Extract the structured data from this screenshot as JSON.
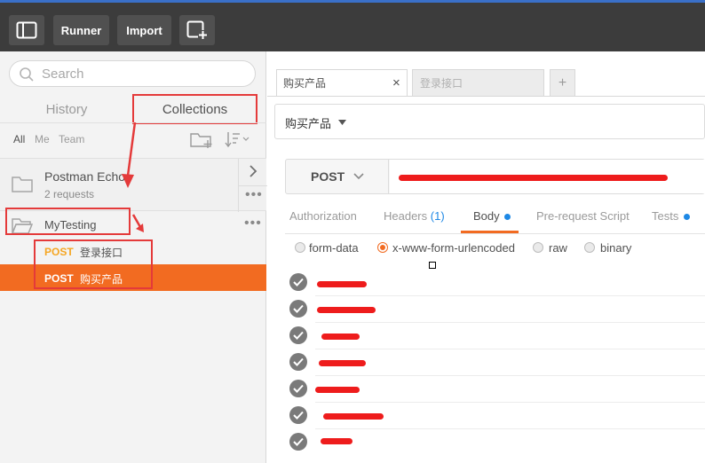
{
  "toolbar": {
    "runner_label": "Runner",
    "import_label": "Import"
  },
  "sidebar": {
    "search_placeholder": "Search",
    "tabs": {
      "history": "History",
      "collections": "Collections"
    },
    "filters": {
      "all": "All",
      "me": "Me",
      "team": "Team"
    },
    "collections": [
      {
        "name": "Postman Echo",
        "count": "2 requests"
      },
      {
        "name": "MyTesting"
      }
    ],
    "requests": [
      {
        "method": "POST",
        "name": "登录接口"
      },
      {
        "method": "POST",
        "name": "购买产品"
      }
    ]
  },
  "main": {
    "tabs": [
      {
        "label": "购买产品"
      },
      {
        "label": "登录接口"
      }
    ],
    "request_name": "购买产品",
    "method": "POST",
    "subtabs": {
      "authorization": "Authorization",
      "headers": "Headers",
      "headers_count": "(1)",
      "body": "Body",
      "prerequest": "Pre-request Script",
      "tests": "Tests"
    },
    "body_options": [
      "form-data",
      "x-www-form-urlencoded",
      "raw",
      "binary"
    ]
  },
  "colors": {
    "accent": "#f26b21",
    "annotation_red": "#e43a3a",
    "topbar_bg": "#3c3c3c",
    "active_blue": "#1e88e5"
  }
}
